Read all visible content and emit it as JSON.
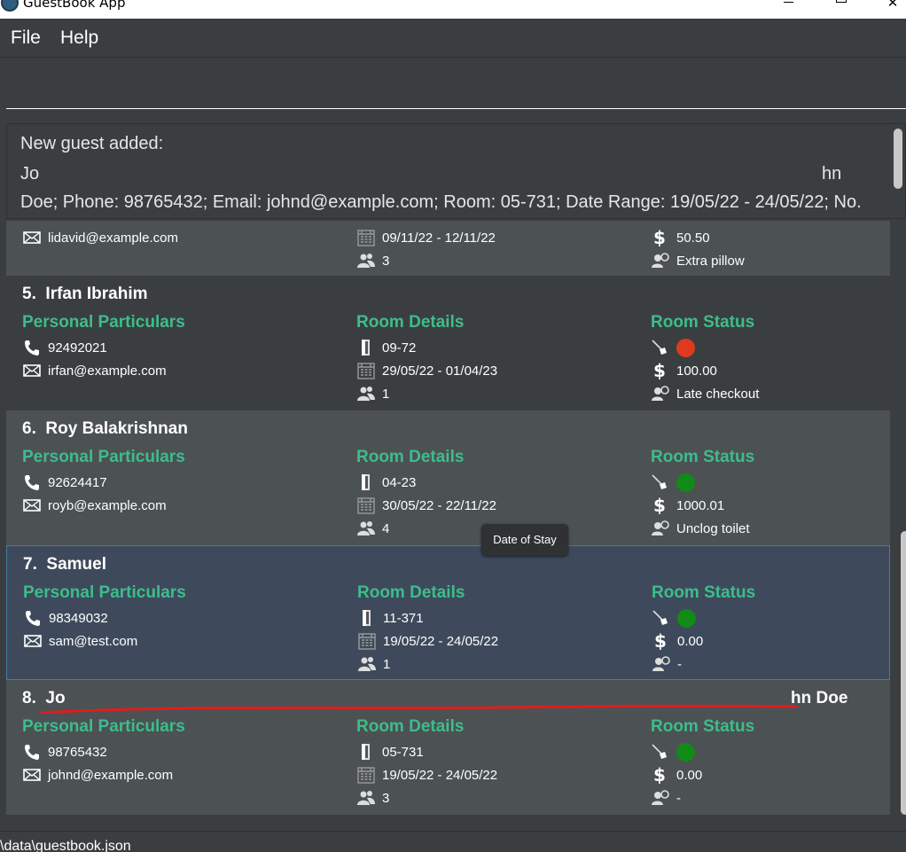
{
  "window": {
    "title": "GuestBook App",
    "icon": "guestbook-app-icon",
    "controls": {
      "minimize": "minimize-icon",
      "maximize": "maximize-icon",
      "close": "✕"
    }
  },
  "menu": {
    "file": "File",
    "help": "Help"
  },
  "command": {
    "value": "",
    "placeholder": ""
  },
  "result": {
    "line1": "New guest added:",
    "line2_start": "Jo",
    "line2_end": "hn",
    "line3": "Doe; Phone: 98765432; Email: johnd@example.com; Room: 05-731; Date Range: 19/05/22 - 24/05/22; No."
  },
  "list": {
    "section_personal": "Personal Particulars",
    "section_room": "Room Details",
    "section_status": "Room Status",
    "partial_top": {
      "email": "lidavid@example.com",
      "date_range": "09/11/22 - 12/11/22",
      "price": "50.50",
      "pax": "3",
      "request": "Extra pillow"
    },
    "guests": [
      {
        "index": "5.",
        "name": "Irfan Ibrahim",
        "name_tail": "",
        "phone": "92492021",
        "email": "irfan@example.com",
        "room": "09-72",
        "date_range": "29/05/22 - 01/04/23",
        "pax": "1",
        "cleaned": "dirty",
        "price": "100.00",
        "request": "Late checkout"
      },
      {
        "index": "6.",
        "name": "Roy Balakrishnan",
        "name_tail": "",
        "phone": "92624417",
        "email": "royb@example.com",
        "room": "04-23",
        "date_range": "30/05/22 - 22/11/22",
        "pax": "4",
        "cleaned": "clean",
        "price": "1000.01",
        "request": "Unclog toilet"
      },
      {
        "index": "7.",
        "name": "Samuel",
        "name_tail": "",
        "phone": "98349032",
        "email": "sam@test.com",
        "room": "11-371",
        "date_range": "19/05/22 - 24/05/22",
        "pax": "1",
        "cleaned": "clean",
        "price": "0.00",
        "request": "-"
      },
      {
        "index": "8.",
        "name": "Jo",
        "name_tail": "hn Doe",
        "phone": "98765432",
        "email": "johnd@example.com",
        "room": "05-731",
        "date_range": "19/05/22 - 24/05/22",
        "pax": "3",
        "cleaned": "clean",
        "price": "0.00",
        "request": "-"
      }
    ]
  },
  "tooltip": {
    "text": "Date of Stay"
  },
  "status_bar": {
    "path": "\\data\\guestbook.json"
  },
  "colors": {
    "section_title": "#3dbd8b",
    "dirty": "#e03a1e",
    "clean": "#118a16",
    "annotation": "#e01c1c",
    "selected_card": "#3e4a5c"
  }
}
